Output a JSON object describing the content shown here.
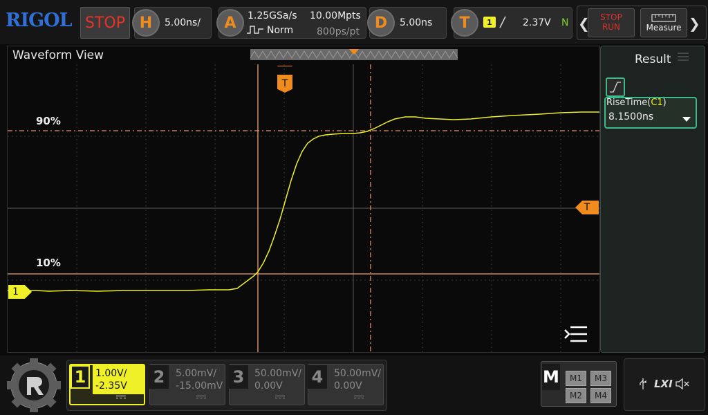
{
  "brand": "RIGOL",
  "run_state": "STOP",
  "horizontal": {
    "label": "H",
    "value": "5.00ns/"
  },
  "acquire": {
    "label": "A",
    "sample_rate": "1.25GSa/s",
    "depth": "10.00Mpts",
    "mode": "Norm",
    "resolution": "800ps/pt"
  },
  "delay": {
    "label": "D",
    "value": "5.00ns"
  },
  "trigger": {
    "label": "T",
    "channel": "1",
    "level": "2.37V",
    "sweep": "N"
  },
  "run_stop_button": {
    "line1": "STOP",
    "line2": "RUN"
  },
  "measure_button": {
    "label": "Measure"
  },
  "waveform_view": {
    "title": "Waveform View"
  },
  "markers": {
    "level90": "90%",
    "level10": "10%",
    "trigger_time": "T",
    "trigger_level": "T",
    "channel_ref": "1"
  },
  "result_panel": {
    "title": "Result",
    "item_name": "RiseTime(",
    "item_channel": "C1",
    "item_close": ")",
    "item_value": "8.1500ns"
  },
  "channels": [
    {
      "num": "1",
      "scale": "1.00V/",
      "offset": "-2.35V",
      "active": true
    },
    {
      "num": "2",
      "scale": "5.00mV/",
      "offset": "-15.00mV",
      "active": false
    },
    {
      "num": "3",
      "scale": "50.00mV/",
      "offset": "0.00V",
      "active": false
    },
    {
      "num": "4",
      "scale": "50.00mV/",
      "offset": "0.00V",
      "active": false
    }
  ],
  "math": {
    "label": "M",
    "items": [
      "M1",
      "M3",
      "M2",
      "M4"
    ]
  },
  "status": {
    "lxi": "LXI"
  },
  "colors": {
    "channel1": "#f0f028",
    "accent": "#f08c1e",
    "cursor": "#f0a070",
    "stop_red": "#e8322a",
    "logo_blue": "#2f6fd6",
    "result_green": "#3fb88a"
  }
}
